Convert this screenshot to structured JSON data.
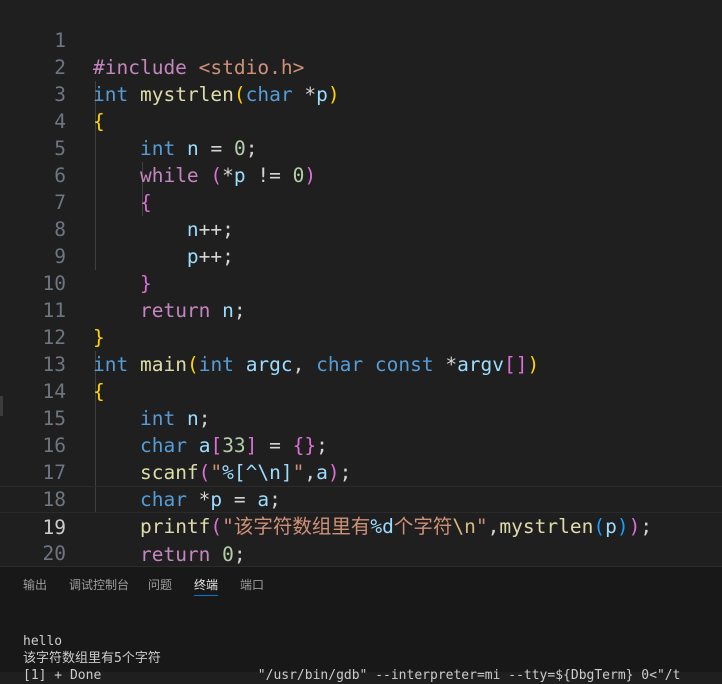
{
  "editor": {
    "line_numbers": [
      "1",
      "2",
      "3",
      "4",
      "5",
      "6",
      "7",
      "8",
      "9",
      "10",
      "11",
      "12",
      "13",
      "14",
      "15",
      "16",
      "17",
      "18",
      "19",
      "20"
    ],
    "current_line": "19",
    "tokens": {
      "l1_a": "#include",
      "l1_b": "<stdio.h>",
      "l2_int": "int",
      "l2_fn": "mystrlen",
      "l2_open": "(",
      "l2_char": "char",
      "l2_star": " *",
      "l2_p": "p",
      "l2_close": ")",
      "l3": "{",
      "l4_int": "int",
      "l4_n": "n",
      "l4_eq": " = ",
      "l4_num": "0",
      "l4_semi": ";",
      "l5_while": "while",
      "l5_open": "(",
      "l5_star": "*",
      "l5_p": "p",
      "l5_ne": " != ",
      "l5_num": "0",
      "l5_close": ")",
      "l6": "{",
      "l7_n": "n",
      "l7_op": "++;",
      "l8_p": "p",
      "l8_op": "++;",
      "l9": "}",
      "l10_ret": "return",
      "l10_n": "n",
      "l10_semi": ";",
      "l11": "}",
      "l12_int": "int",
      "l12_fn": "main",
      "l12_open": "(",
      "l12_int2": "int",
      "l12_argc": "argc",
      "l12_comma": ",",
      "l12_char": "char",
      "l12_const": "const",
      "l12_star": " *",
      "l12_argv": "argv",
      "l12_bopen": "[",
      "l12_bclose": "]",
      "l12_close": ")",
      "l13": "{",
      "l14_int": "int",
      "l14_n": "n",
      "l14_semi": ";",
      "l15_char": "char",
      "l15_a": "a",
      "l15_bopen": "[",
      "l15_num": "33",
      "l15_bclose": "]",
      "l15_eq": " = ",
      "l15_braces": "{}",
      "l15_semi": ";",
      "l16_fn": "scanf",
      "l16_open": "(",
      "l16_q1": "\"",
      "l16_fmt": "%[^\\n]",
      "l16_q2": "\"",
      "l16_comma": ",",
      "l16_a": "a",
      "l16_close": ")",
      "l16_semi": ";",
      "l17_char": "char",
      "l17_star": " *",
      "l17_p": "p",
      "l17_eq": " = ",
      "l17_a": "a",
      "l17_semi": ";",
      "l18_fn": "printf",
      "l18_open": "(",
      "l18_str1": "\"该字符数组里有",
      "l18_fmt": "%d",
      "l18_str2": "个字符",
      "l18_esc": "\\n",
      "l18_q": "\"",
      "l18_comma": ",",
      "l18_fn2": "mystrlen",
      "l18_open2": "(",
      "l18_p": "p",
      "l18_close2": ")",
      "l18_close": ")",
      "l18_semi": ";",
      "l19_ret": "return",
      "l19_num": "0",
      "l19_semi": ";",
      "l20": "}"
    }
  },
  "panel": {
    "tabs": [
      "输出",
      "调试控制台",
      "问题",
      "终端",
      "端口"
    ],
    "active_tab": "终端",
    "terminal_lines": [
      "hello",
      "该字符数组里有5个字符",
      "[1] + Done                    \"/usr/bin/gdb\" --interpreter=mi --tty=${DbgTerm} 0<\"/t"
    ]
  },
  "colors": {
    "background": "#1f1f1f",
    "keyword_type": "#569cd6",
    "function": "#dcdcaa",
    "string": "#ce9178",
    "variable": "#9cdcfe",
    "number": "#b5cea8",
    "control": "#c586c0",
    "bracket_level1": "#ffd700",
    "bracket_level2": "#da70d6",
    "bracket_level3": "#179fff",
    "active_tab_underline": "#0078d4"
  }
}
